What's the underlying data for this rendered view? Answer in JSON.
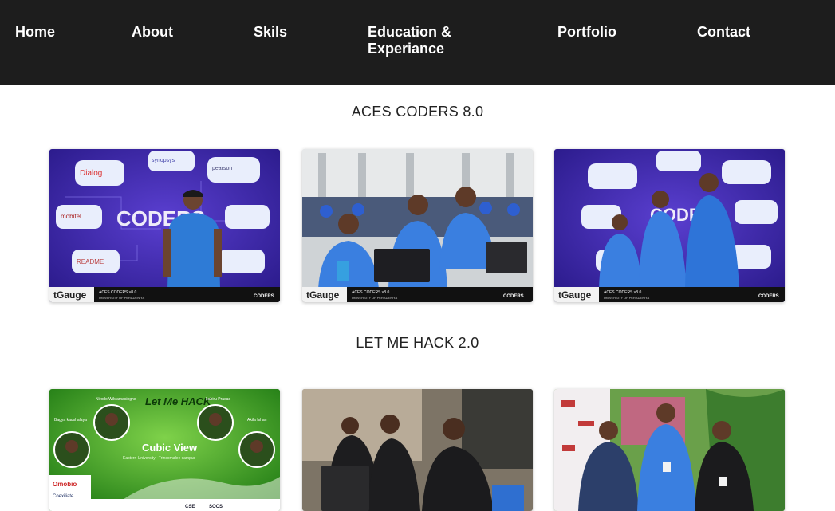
{
  "nav": {
    "items": [
      {
        "label": "Home"
      },
      {
        "label": "About"
      },
      {
        "label": "Skils"
      },
      {
        "label": "Education & Experiance"
      },
      {
        "label": "Portfolio"
      },
      {
        "label": "Contact"
      }
    ]
  },
  "sections": [
    {
      "title": "ACES CODERS 8.0",
      "photos": [
        {
          "banner_text": "CODERS",
          "footer_brand": "tGauge",
          "footer_title": "ACES CODERS v8.0",
          "footer_sub": "UNIVERSITY OF PERADENIYA",
          "footer_logo": "CODERS"
        },
        {
          "footer_brand": "tGauge",
          "footer_title": "ACES CODERS v8.0",
          "footer_sub": "UNIVERSITY OF PERADENIYA",
          "footer_logo": "CODERS"
        },
        {
          "banner_text": "CODERS",
          "footer_brand": "tGauge",
          "footer_title": "ACES CODERS v8.0",
          "footer_sub": "UNIVERSITY OF PERADENIYA",
          "footer_logo": "CODERS"
        }
      ],
      "sponsor_labels": [
        "Dialog",
        "synopsys",
        "pearson",
        "mobitel",
        "README"
      ]
    },
    {
      "title": "LET ME HACK 2.0",
      "photos": [
        {
          "poster_logo": "Let Me HACK",
          "team_name": "Cubic View",
          "university": "Eastern University - Trincomalee campus",
          "members": [
            "Nirodo Wikramasinghe",
            "Lahiru Prasad",
            "Bagya kaushalaya",
            "Akila Ishan"
          ],
          "sponsors": [
            "Omobio",
            "Coexiliate",
            "CSE",
            "SOCS"
          ]
        },
        {},
        {}
      ]
    }
  ],
  "colors": {
    "nav_bg": "#1d1d1d",
    "nav_text": "#ffffff",
    "coders_purple": "#3a2a9e",
    "hack_green": "#2f8f1f"
  }
}
